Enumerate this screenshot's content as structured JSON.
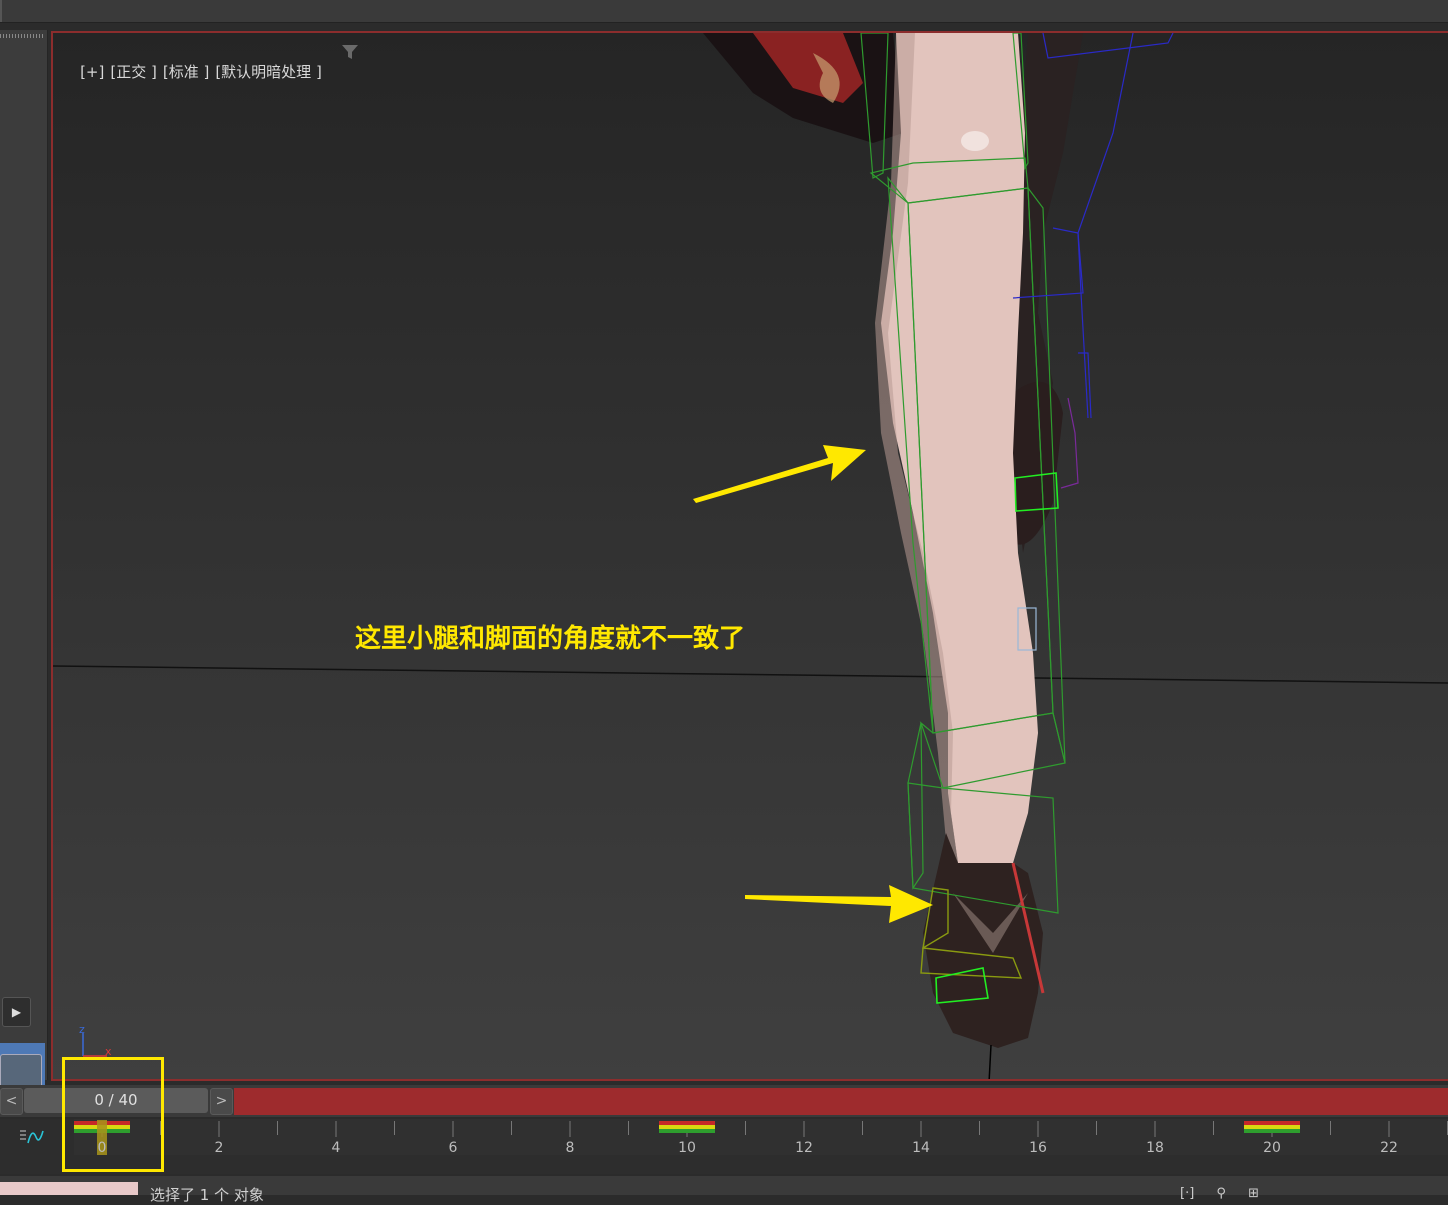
{
  "viewport": {
    "labels": [
      "[+]",
      "[正交 ]",
      "[标准 ]",
      "[默认明暗处理 ]"
    ],
    "annotation": "这里小腿和脚面的角度就不一致了",
    "axis": {
      "z": "z",
      "x": "x"
    }
  },
  "timeslider": {
    "frame_text": "0 / 40",
    "prev_label": "<",
    "next_label": ">"
  },
  "trackbar": {
    "tick_labels": [
      "0",
      "2",
      "4",
      "6",
      "8",
      "10",
      "12",
      "14",
      "16",
      "18",
      "20",
      "22"
    ],
    "keyframes": [
      0,
      10,
      20
    ]
  },
  "status": {
    "text": "选择了 1 个 对象"
  },
  "colors": {
    "annotation": "#ffe800",
    "viewport_border": "#8c2d2d",
    "time_track": "#9e2b2d",
    "bone_green": "#2f9b2f",
    "bone_blue": "#2a2ac8"
  },
  "icons": [
    "filter-icon",
    "play-icon",
    "curve-editor-icon",
    "zoom-extents-icon",
    "pan-icon",
    "viewport-layout-icon"
  ]
}
